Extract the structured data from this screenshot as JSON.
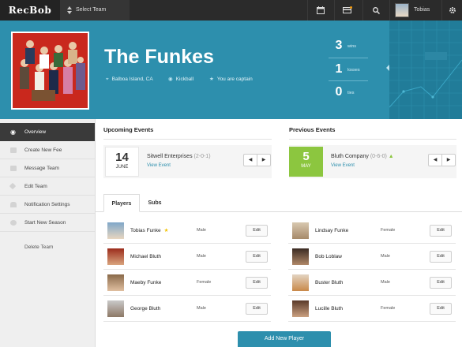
{
  "app": {
    "logo": "RecBob"
  },
  "topbar": {
    "team_select": "Select Team",
    "user_name": "Tobias"
  },
  "team": {
    "name": "The Funkes",
    "location": "Balboa Island, CA",
    "sport": "Kickball",
    "role": "You are captain"
  },
  "record": {
    "wins": "3",
    "wins_label": "wins",
    "losses": "1",
    "losses_label": "losses",
    "ties": "0",
    "ties_label": "ties"
  },
  "sidebar": {
    "items": [
      {
        "label": "Overview",
        "icon": "eye-icon"
      },
      {
        "label": "Create New Fee",
        "icon": "card-icon"
      },
      {
        "label": "Message Team",
        "icon": "mail-icon"
      },
      {
        "label": "Edit Team",
        "icon": "pencil-icon"
      },
      {
        "label": "Notification Settings",
        "icon": "bell-icon"
      },
      {
        "label": "Start New Season",
        "icon": "refresh-icon"
      }
    ],
    "delete_label": "Delete Team"
  },
  "upcoming": {
    "title": "Upcoming Events",
    "day": "14",
    "month": "JUNE",
    "opponent": "Sitwell Enterprises",
    "record": "(2-0-1)",
    "link": "View Event"
  },
  "previous": {
    "title": "Previous Events",
    "day": "5",
    "month": "MAY",
    "opponent": "Bluth Company",
    "record": "(0-6-0)",
    "link": "View Event"
  },
  "pager": {
    "prev": "◀",
    "next": "▶"
  },
  "tabs": {
    "players": "Players",
    "subs": "Subs"
  },
  "players_left": [
    {
      "name": "Tobias Funke",
      "gender": "Male",
      "captain": "★"
    },
    {
      "name": "Michael Bluth",
      "gender": "Male"
    },
    {
      "name": "Maeby Funke",
      "gender": "Female"
    },
    {
      "name": "George Bluth",
      "gender": "Male"
    }
  ],
  "players_right": [
    {
      "name": "Lindsay Funke",
      "gender": "Female"
    },
    {
      "name": "Bob Loblaw",
      "gender": "Male"
    },
    {
      "name": "Buster Bluth",
      "gender": "Male"
    },
    {
      "name": "Lucille Bluth",
      "gender": "Female"
    }
  ],
  "edit_label": "Edit",
  "add_player_label": "Add New Player",
  "colors": {
    "accent": "#2d8fad",
    "topbar": "#2b2b2b",
    "win": "#8cc63f",
    "sidebar_active": "#3a3a3a"
  }
}
